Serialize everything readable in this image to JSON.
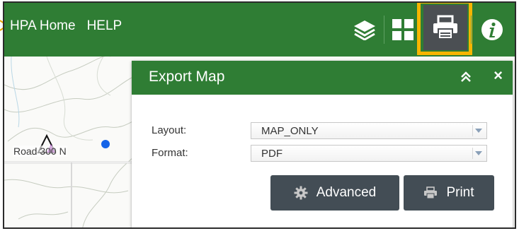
{
  "header": {
    "nav": [
      "HPA Home",
      "HELP"
    ],
    "tools": {
      "layers_icon": "layers-icon",
      "grid_icon": "basemap-grid-icon",
      "print_icon": "printer-icon",
      "info_icon": "info-icon"
    },
    "highlight_color": "#f7b500"
  },
  "map": {
    "road_label": "Road 300 N"
  },
  "export_panel": {
    "title": "Export Map",
    "layout_label": "Layout:",
    "layout_value": "MAP_ONLY",
    "format_label": "Format:",
    "format_value": "PDF",
    "advanced_label": "Advanced",
    "print_label": "Print"
  },
  "colors": {
    "header_green": "#2f7d34",
    "button_dark": "#434d55",
    "print_tool_bg": "#4b4f53"
  }
}
